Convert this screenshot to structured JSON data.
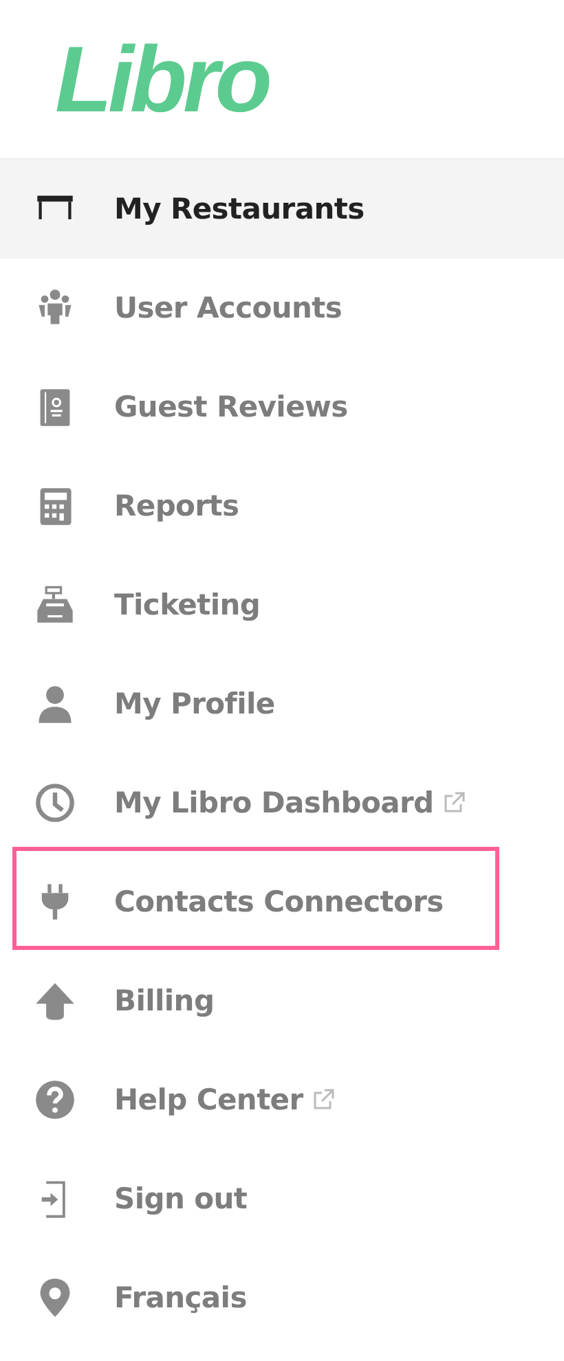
{
  "logo": {
    "text": "Libro"
  },
  "menu": [
    {
      "label": "My Restaurants",
      "kind": "table",
      "selected": true,
      "external": false,
      "highlighted": false
    },
    {
      "label": "User Accounts",
      "kind": "people",
      "selected": false,
      "external": false,
      "highlighted": false
    },
    {
      "label": "Guest Reviews",
      "kind": "book",
      "selected": false,
      "external": false,
      "highlighted": false
    },
    {
      "label": "Reports",
      "kind": "calculator",
      "selected": false,
      "external": false,
      "highlighted": false
    },
    {
      "label": "Ticketing",
      "kind": "register",
      "selected": false,
      "external": false,
      "highlighted": false
    },
    {
      "label": "My Profile",
      "kind": "person",
      "selected": false,
      "external": false,
      "highlighted": false
    },
    {
      "label": "My Libro Dashboard",
      "kind": "clock",
      "selected": false,
      "external": true,
      "highlighted": false
    },
    {
      "label": "Contacts Connectors",
      "kind": "plug",
      "selected": false,
      "external": false,
      "highlighted": true
    },
    {
      "label": "Billing",
      "kind": "arrow",
      "selected": false,
      "external": false,
      "highlighted": false
    },
    {
      "label": "Help Center",
      "kind": "help",
      "selected": false,
      "external": true,
      "highlighted": false
    },
    {
      "label": "Sign out",
      "kind": "signout",
      "selected": false,
      "external": false,
      "highlighted": false
    },
    {
      "label": "Français",
      "kind": "pin",
      "selected": false,
      "external": false,
      "highlighted": false
    }
  ]
}
